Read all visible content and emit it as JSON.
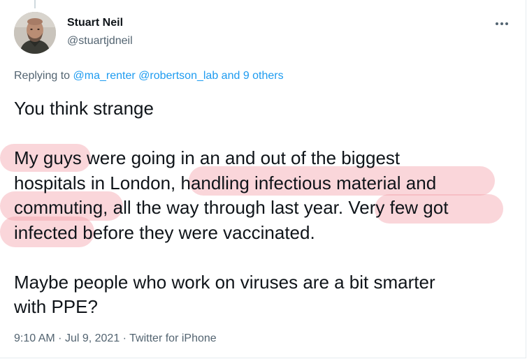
{
  "tweet": {
    "author": {
      "name": "Stuart Neil",
      "handle": "@stuartjdneil"
    },
    "replying": {
      "prefix": "Replying to",
      "mentions": [
        "@ma_renter",
        "@robertson_lab"
      ],
      "others": "and 9 others"
    },
    "body": {
      "line1": "You think strange",
      "line2": "My guys were going in an and out of the biggest",
      "line3": "hospitals in London, handling infectious material and",
      "line4": "commuting, all the way through last year. Very few got",
      "line5": "infected before they were vaccinated.",
      "line6": "Maybe people who work on viruses are a bit smarter",
      "line7": "with PPE?"
    },
    "meta": {
      "time": "9:10 AM",
      "separator": "·",
      "date": "Jul 9, 2021",
      "source": "Twitter for iPhone"
    },
    "icons": {
      "more": "more-horizontal-icon",
      "avatar": "profile-photo"
    },
    "colors": {
      "link": "#1d9bf0",
      "secondary": "#536471",
      "highlight": "#f4a0a8"
    }
  }
}
